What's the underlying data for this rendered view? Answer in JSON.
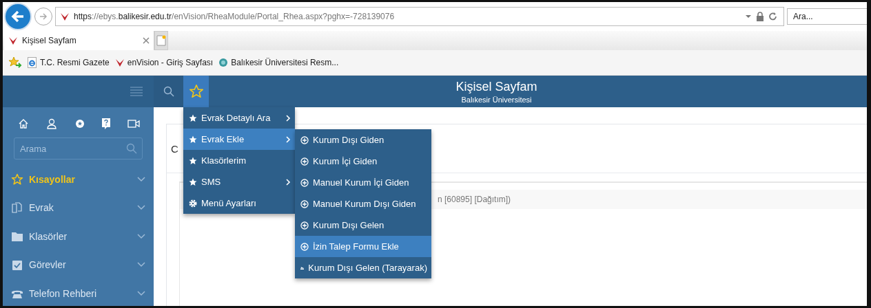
{
  "browser": {
    "url": "**https**://ebys.**balikesir.edu.tr**/enVision/RheaModule/Portal_Rhea.aspx?pghx=-728139076",
    "search": {
      "placeholder": "Ara..."
    },
    "tabs": [
      {
        "label": "Kişisel Sayfam",
        "selected": true
      }
    ],
    "favorites": [
      {
        "label": "T.C. Resmi Gazete",
        "kind": "ie"
      },
      {
        "label": "enVision - Giriş Sayfası",
        "kind": "envision"
      },
      {
        "label": "Balıkesir Üniversitesi Resm...",
        "kind": "globe"
      }
    ]
  },
  "header": {
    "title": "Kişisel Sayfam",
    "subtitle": "Balıkesir Üniversitesi"
  },
  "sidebar": {
    "search": {
      "placeholder": "Arama"
    },
    "items": [
      {
        "label": "Kısayollar",
        "kind": "star",
        "selected": true
      },
      {
        "label": "Evrak",
        "kind": "docs",
        "selected": false
      },
      {
        "label": "Klasörler",
        "kind": "folder",
        "selected": false
      },
      {
        "label": "Görevler",
        "kind": "task",
        "selected": false
      },
      {
        "label": "Telefon Rehberi",
        "kind": "phone",
        "selected": false
      }
    ]
  },
  "content": {
    "heading": "C",
    "row_text": "n [60895] [Dağıtım])"
  },
  "menu": [
    {
      "label": "Evrak Detaylı Ara",
      "kind": "star",
      "has_submenu": true,
      "selected": false
    },
    {
      "label": "Evrak Ekle",
      "kind": "star",
      "has_submenu": true,
      "selected": true
    },
    {
      "label": "Klasörlerim",
      "kind": "star",
      "has_submenu": false,
      "selected": false
    },
    {
      "label": "SMS",
      "kind": "star",
      "has_submenu": true,
      "selected": false
    },
    {
      "label": "Menü Ayarları",
      "kind": "gear",
      "has_submenu": false,
      "selected": false
    }
  ],
  "submenu": [
    {
      "label": "Kurum Dışı Giden",
      "kind": "add",
      "selected": false
    },
    {
      "label": "Kurum İçi Giden",
      "kind": "add",
      "selected": false
    },
    {
      "label": "Manuel Kurum İçi Giden",
      "kind": "add",
      "selected": false
    },
    {
      "label": "Manuel Kurum Dışı Giden",
      "kind": "add",
      "selected": false
    },
    {
      "label": "Kurum Dışı Gelen",
      "kind": "add",
      "selected": false
    },
    {
      "label": "İzin Talep Formu Ekle",
      "kind": "add",
      "selected": true
    },
    {
      "label": "Kurum Dışı Gelen (Tarayarak)",
      "kind": "scan",
      "selected": false
    }
  ]
}
